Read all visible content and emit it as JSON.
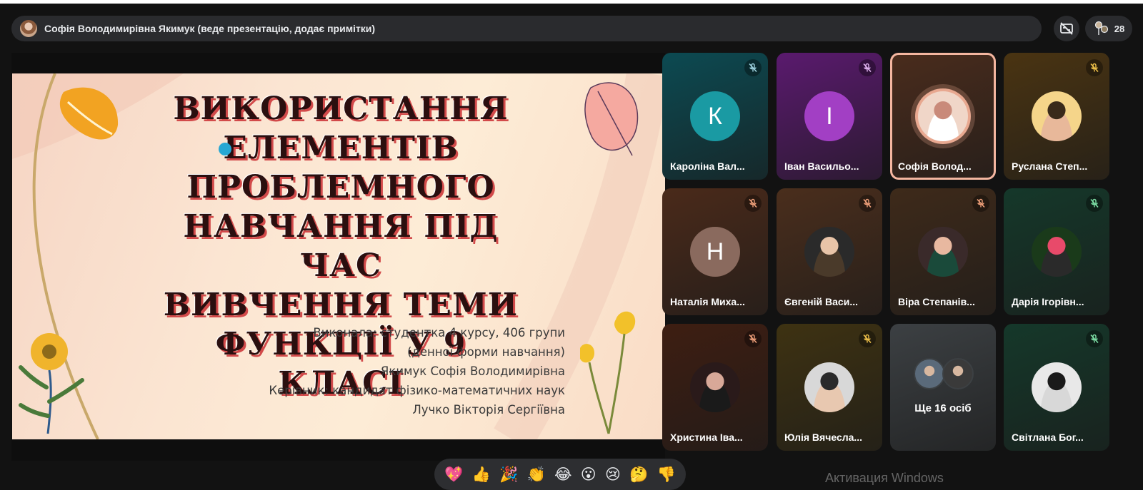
{
  "top_bar": {
    "presenter_label": "Софія Володимирівна Якимук (веде презентацію, додає примітки)",
    "participants_count": "28"
  },
  "slide": {
    "title_lines": [
      "ВИКОРИСТАННЯ",
      "ЕЛЕМЕНТІВ",
      "ПРОБЛЕМНОГО",
      "НАВЧАННЯ ПІД ЧАС",
      "ВИВЧЕННЯ ТЕМИ",
      "ФУНКЦІЇ У 9 КЛАСІ"
    ],
    "info_lines": [
      "Виконала: студентка 4 курсу, 406 групи",
      "(денної форми навчання)",
      "Якимук Софія Володимирівна",
      "Керівник: кандидат фізико-математичних наук",
      "Лучко Вікторія Сергіївна"
    ]
  },
  "participants": [
    {
      "name": "Кароліна Вал...",
      "letter": "К",
      "avatar_color": "#1a9aa3",
      "tile_color": "#0c4a52",
      "mic_color": "#9fd3e0"
    },
    {
      "name": "Іван Васильо...",
      "letter": "І",
      "avatar_color": "#a23fc4",
      "tile_color": "#5a1a6e",
      "mic_color": "#e0b4f0"
    },
    {
      "name": "Софія Волод...",
      "letter": "",
      "tile_color": "#4a2c1c",
      "mic_color": "",
      "speaking": true
    },
    {
      "name": "Руслана Степ...",
      "letter": "",
      "tile_color": "#4a3412",
      "mic_color": "#f0c24a"
    },
    {
      "name": "Наталія Миха...",
      "letter": "Н",
      "avatar_color": "#8a6a5e",
      "tile_color": "#4a2a1a",
      "mic_color": "#f0a07a"
    },
    {
      "name": "Євгеній Васи...",
      "letter": "",
      "tile_color": "#4a2e1c",
      "mic_color": "#f0a07a"
    },
    {
      "name": "Віра Степанів...",
      "letter": "",
      "tile_color": "#3e2a1a",
      "mic_color": "#f0a07a"
    },
    {
      "name": "Дарія Ігорівн...",
      "letter": "",
      "tile_color": "#15382a",
      "mic_color": "#7ee0a6"
    },
    {
      "name": "Христина Іва...",
      "letter": "",
      "tile_color": "#3e1e12",
      "mic_color": "#f0a07a"
    },
    {
      "name": "Юлія Вячесла...",
      "letter": "",
      "tile_color": "#3e3212",
      "mic_color": "#f0c24a"
    },
    {
      "name": "",
      "letter": "",
      "tile_color": "#3c4043",
      "mic_color": "",
      "more_label": "Ще 16 осіб"
    },
    {
      "name": "Світлана Бог...",
      "letter": "",
      "tile_color": "#15382a",
      "mic_color": "#7ee0a6"
    }
  ],
  "reactions": [
    "💖",
    "👍",
    "🎉",
    "👏",
    "😂",
    "😮",
    "😢",
    "🤔",
    "👎"
  ],
  "watermark": "Активация Windows"
}
